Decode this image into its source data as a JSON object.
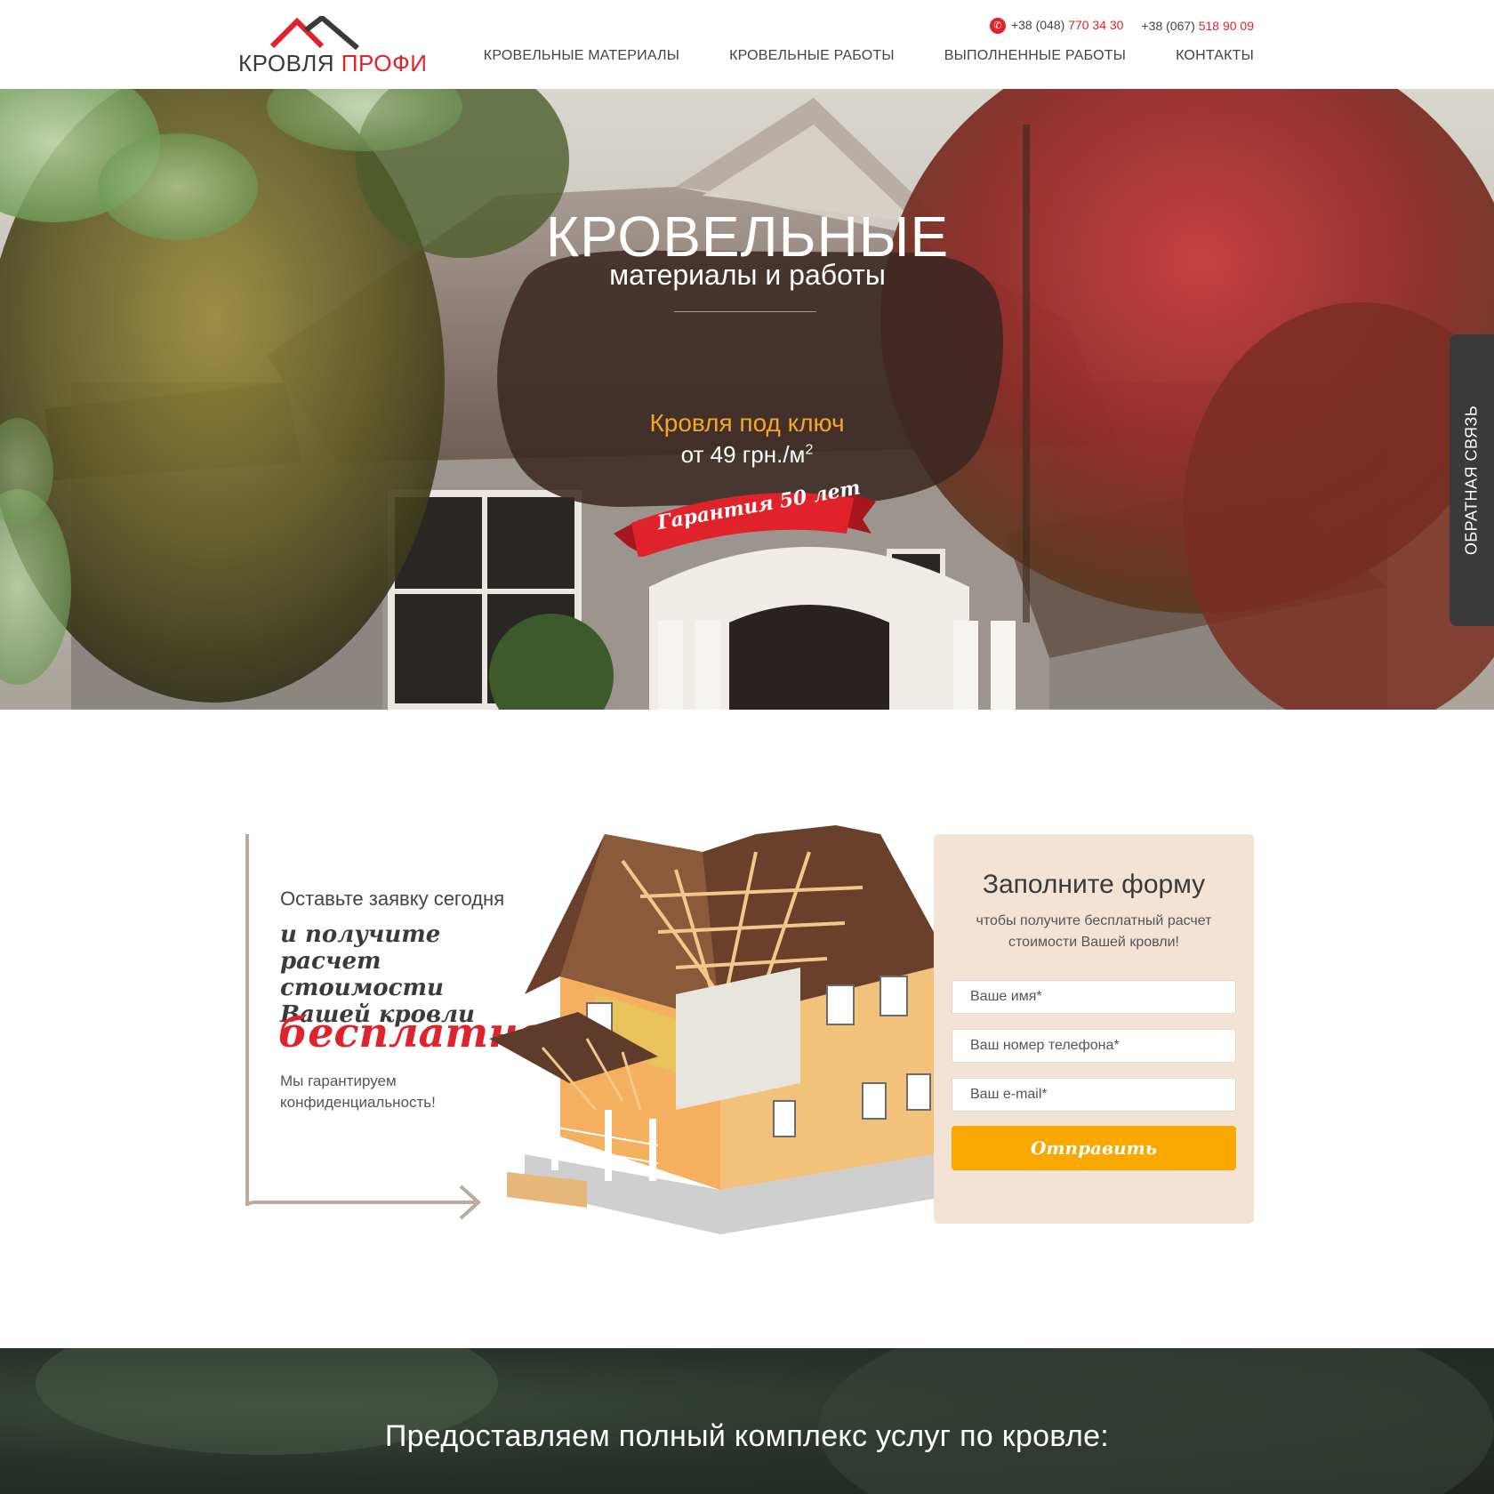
{
  "brand": {
    "logo_word1": "КРОВЛЯ",
    "logo_word2": "ПРОФИ",
    "accent": "#e0222b",
    "dark": "#3a3a3a"
  },
  "header": {
    "phone1_prefix": "+38 (048)",
    "phone1_number": "770 34 30",
    "phone2_prefix": "+38 (067)",
    "phone2_number": "518 90 09",
    "nav": [
      {
        "label": "КРОВЕЛЬНЫЕ МАТЕРИАЛЫ"
      },
      {
        "label": "КРОВЕЛЬНЫЕ РАБОТЫ"
      },
      {
        "label": "ВЫПОЛНЕННЫЕ РАБОТЫ"
      },
      {
        "label": "КОНТАКТЫ"
      }
    ]
  },
  "hero": {
    "title": "КРОВЕЛЬНЫЕ",
    "subtitle": "материалы и работы",
    "offer": "Кровля под ключ",
    "price": "от 49 грн./м",
    "price_sup": "2",
    "ribbon": "Гарантия 50 лет",
    "ribbon_color": "#e0222b",
    "offer_color": "#f5a623"
  },
  "feedback_tab": {
    "label": "ОБРАТНАЯ СВЯЗЬ"
  },
  "lead": {
    "line1": "Оставьте заявку сегодня",
    "line2": "и получите расчет стоимости Вашей кровли",
    "line3": "бесплатно",
    "line4": "Мы гарантируем конфиденциальность!"
  },
  "form": {
    "title": "Заполните форму",
    "subtitle": "чтобы получите бесплатный расчет стоимости Вашей кровли!",
    "name_placeholder": "Ваше имя*",
    "phone_placeholder": "Ваш номер телефона*",
    "email_placeholder": "Ваш e-mail*",
    "submit_label": "Отправить",
    "button_color": "#f9a800"
  },
  "services": {
    "title": "Предоставляем полный комплекс услуг по кровле:"
  }
}
